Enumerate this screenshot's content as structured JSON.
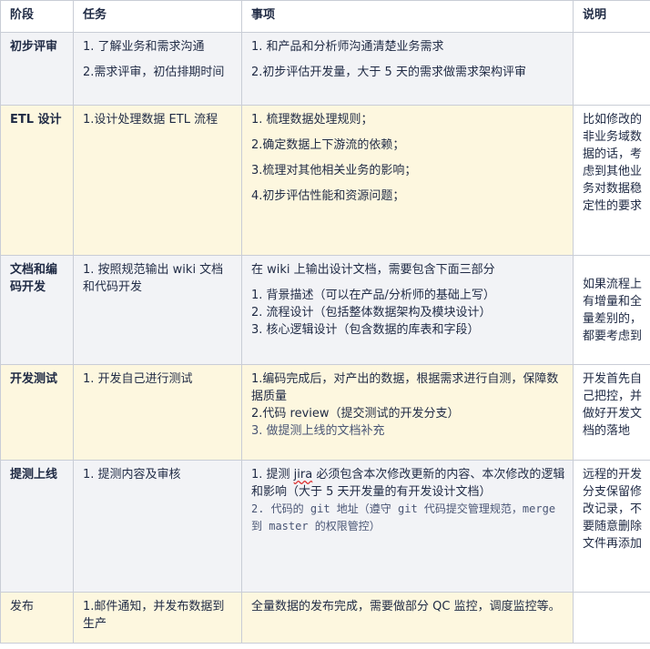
{
  "headers": [
    "阶段",
    "任务",
    "事项",
    "说明"
  ],
  "rows": [
    {
      "stage": "初步评审",
      "tasks": [
        "1. 了解业务和需求沟通",
        "2.需求评审，初估排期时间"
      ],
      "items": [
        "1. 和产品和分析师沟通清楚业务需求",
        "2.初步评估开发量，大于 5 天的需求做需求架构评审"
      ],
      "note": ""
    },
    {
      "stage": "ETL 设计",
      "tasks": [
        "1.设计处理数据 ETL 流程"
      ],
      "items": [
        "1. 梳理数据处理规则；",
        "2.确定数据上下游流的依赖；",
        "3.梳理对其他相关业务的影响；",
        "4.初步评估性能和资源问题；"
      ],
      "note": "比如修改的非业务域数据的话，考虑到其他业务对数据稳定性的要求"
    },
    {
      "stage": "文档和编码开发",
      "tasks": [
        "1. 按照规范输出 wiki 文档和代码开发"
      ],
      "items_intro": "在 wiki 上输出设计文档，需要包含下面三部分",
      "items": [
        "1. 背景描述（可以在产品/分析师的基础上写）",
        "2. 流程设计（包括整体数据架构及模块设计）",
        "3. 核心逻辑设计（包含数据的库表和字段）"
      ],
      "note": "如果流程上有增量和全量差别的，都要考虑到"
    },
    {
      "stage": "开发测试",
      "tasks": [
        "1. 开发自己进行测试"
      ],
      "items": [
        "1.编码完成后，对产出的数据，根据需求进行自测，保障数据质量",
        "2.代码 review（提交测试的开发分支）",
        "3. 做提测上线的文档补充"
      ],
      "note": "开发首先自己把控，并做好开发文档的落地"
    },
    {
      "stage": "提测上线",
      "tasks": [
        "1. 提测内容及审核"
      ],
      "items_a": {
        "prefix": "1. 提测 ",
        "jira": "jira",
        "rest": " 必须包含本次修改更新的内容、本次修改的逻辑和影响（大于 5 天开发量的有开发设计文档）"
      },
      "items_b": "2. 代码的 git 地址（遵守 git 代码提交管理规范，merge 到 master 的权限管控）",
      "note": "远程的开发分支保留修改记录，不要随意删除文件再添加"
    },
    {
      "stage": "发布",
      "tasks": [
        "1.邮件通知，并发布数据到生产"
      ],
      "items": [
        "全量数据的发布完成，需要做部分 QC 监控，调度监控等。"
      ],
      "note": ""
    }
  ]
}
